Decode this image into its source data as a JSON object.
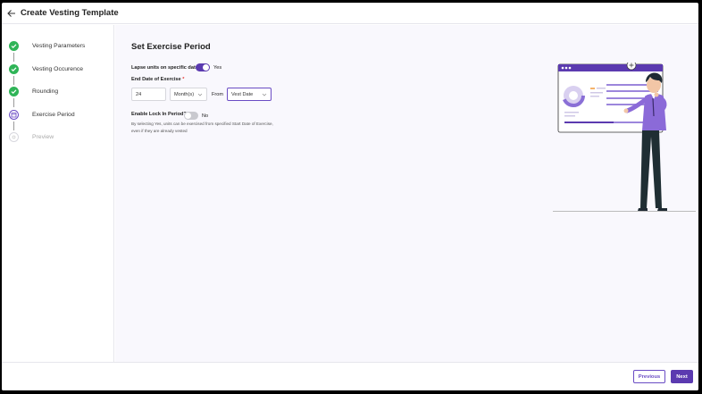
{
  "header": {
    "title": "Create Vesting Template"
  },
  "steps": [
    {
      "label": "Vesting Parameters",
      "state": "done"
    },
    {
      "label": "Vesting Occurence",
      "state": "done"
    },
    {
      "label": "Rounding",
      "state": "done"
    },
    {
      "label": "Exercise Period",
      "state": "current"
    },
    {
      "label": "Preview",
      "state": "pending"
    }
  ],
  "main": {
    "title": "Set Exercise Period",
    "lapse": {
      "label": "Lapse units on specific date?",
      "value_text": "Yes",
      "on": true
    },
    "end_date": {
      "label": "End Date of Exercise",
      "required_mark": "*",
      "quantity": "24",
      "unit": "Month(s)",
      "from_label": "From",
      "from_value": "Vest Date"
    },
    "lock_in": {
      "label": "Enable Lock In Period?",
      "value_text": "No",
      "on": false,
      "help": "By selecting Yes, units can be exercised from specified Start Date of Exercise, even if they are already vested"
    }
  },
  "footer": {
    "previous_label": "Previous",
    "next_label": "Next"
  },
  "colors": {
    "primary": "#5b3ab0",
    "success": "#2fb457",
    "background": "#f9f8fd"
  }
}
